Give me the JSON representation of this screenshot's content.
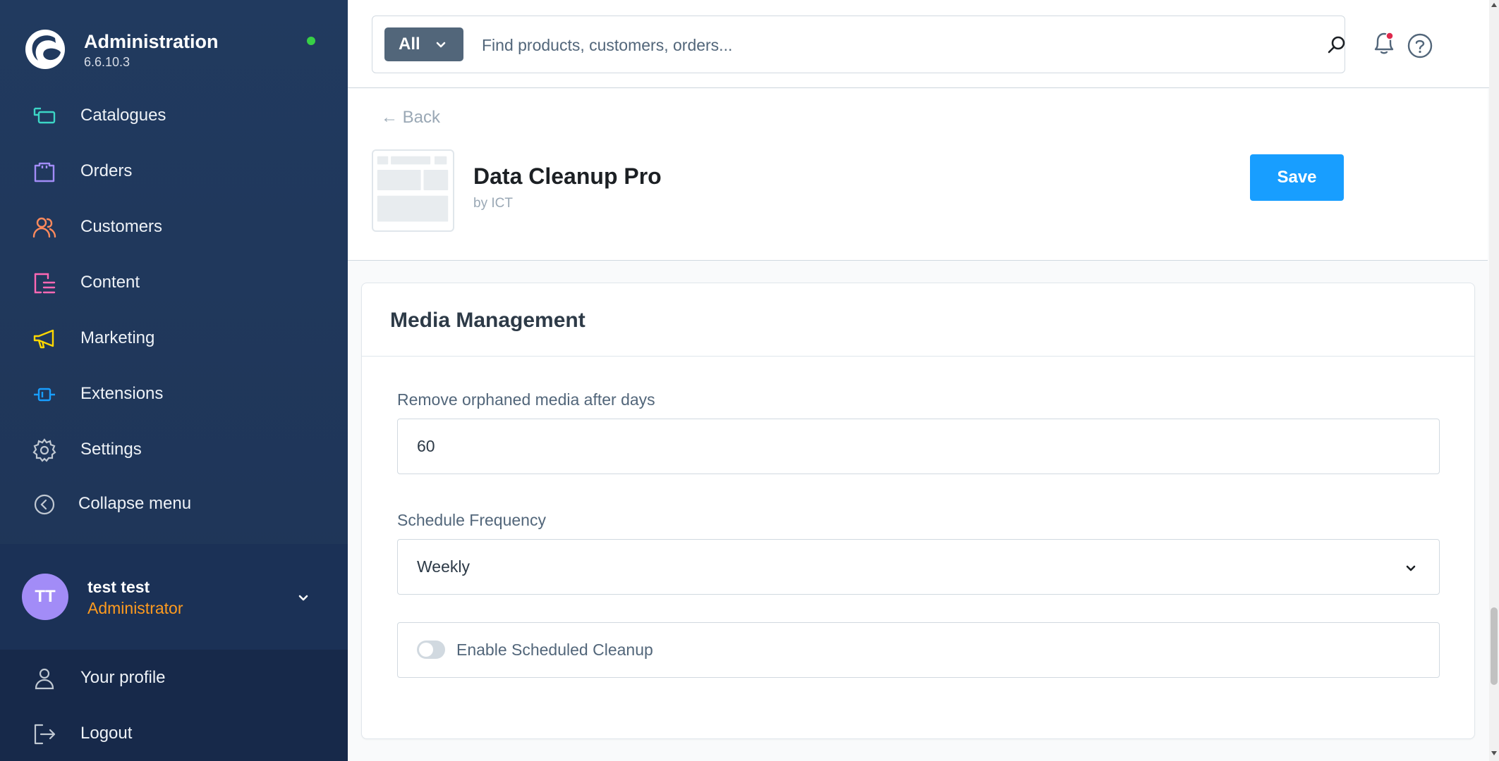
{
  "brand": {
    "title": "Administration",
    "version": "6.6.10.3",
    "status_color": "#37d046"
  },
  "nav": [
    {
      "label": "Catalogues",
      "icon": "catalogue-icon",
      "color": "#3cd6c6"
    },
    {
      "label": "Orders",
      "icon": "shopping-bag-icon",
      "color": "#a28cf7"
    },
    {
      "label": "Customers",
      "icon": "users-icon",
      "color": "#ff8a5c"
    },
    {
      "label": "Content",
      "icon": "content-list-icon",
      "color": "#ff68b4"
    },
    {
      "label": "Marketing",
      "icon": "megaphone-icon",
      "color": "#ffd700"
    },
    {
      "label": "Extensions",
      "icon": "plug-icon",
      "color": "#189eff"
    },
    {
      "label": "Settings",
      "icon": "gear-icon",
      "color": "#c0c8d2"
    },
    {
      "label": "Collapse menu",
      "icon": "chevron-left-circle-icon",
      "color": "#c0c8d2"
    }
  ],
  "user": {
    "initials": "TT",
    "name": "test test",
    "role": "Administrator"
  },
  "account_menu": [
    {
      "label": "Your profile",
      "icon": "user-icon"
    },
    {
      "label": "Logout",
      "icon": "logout-icon"
    }
  ],
  "search": {
    "scope": "All",
    "placeholder": "Find products, customers, orders..."
  },
  "header": {
    "back_label": "Back",
    "app_title": "Data Cleanup Pro",
    "app_author": "by ICT",
    "save_label": "Save"
  },
  "card": {
    "title": "Media Management",
    "fields": {
      "orphaned_label": "Remove orphaned media after days",
      "orphaned_value": "60",
      "frequency_label": "Schedule Frequency",
      "frequency_value": "Weekly",
      "enable_label": "Enable Scheduled Cleanup",
      "enable_checked": false
    }
  },
  "colors": {
    "accent": "#189eff",
    "sidebar": "#213a5f",
    "role": "#ff9b1f",
    "avatar": "#a28cf7",
    "notification": "#de294c"
  }
}
